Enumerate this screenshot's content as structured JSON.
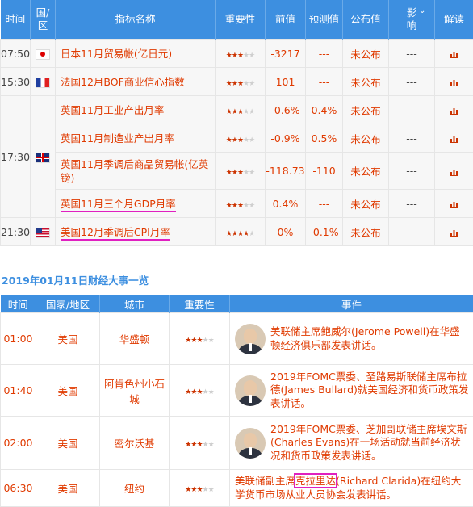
{
  "table1": {
    "headers": {
      "time": "时间",
      "country": "国/区",
      "indicator": "指标名称",
      "importance": "重要性",
      "previous": "前值",
      "forecast": "预测值",
      "actual": "公布值",
      "impact": "影响",
      "impact_icon": "chevron-down-icon",
      "interpret": "解读"
    },
    "rows": [
      {
        "time": "07:50",
        "flag": "japan",
        "name": "日本11月贸易帐(亿日元)",
        "stars": 3,
        "previous": "-3217",
        "forecast": "---",
        "actual": "未公布",
        "impact": "---"
      },
      {
        "time": "15:30",
        "flag": "france",
        "name": "法国12月BOF商业信心指数",
        "stars": 3,
        "previous": "101",
        "forecast": "---",
        "actual": "未公布",
        "impact": "---"
      },
      {
        "time": "17:30",
        "flag": "uk",
        "name": "英国11月工业产出月率",
        "stars": 3,
        "previous": "-0.6%",
        "forecast": "0.4%",
        "actual": "未公布",
        "impact": "---"
      },
      {
        "time": "",
        "flag": "",
        "name": "英国11月制造业产出月率",
        "stars": 3,
        "previous": "-0.9%",
        "forecast": "0.5%",
        "actual": "未公布",
        "impact": "---"
      },
      {
        "time": "",
        "flag": "",
        "name": "英国11月季调后商品贸易帐(亿英镑)",
        "stars": 3,
        "previous": "-118.73",
        "forecast": "-110",
        "actual": "未公布",
        "impact": "---"
      },
      {
        "time": "",
        "flag": "",
        "name": "英国11月三个月GDP月率",
        "stars": 3,
        "previous": "0.4%",
        "forecast": "---",
        "actual": "未公布",
        "impact": "---"
      },
      {
        "time": "21:30",
        "flag": "usa",
        "name": "美国12月季调后CPI月率",
        "stars": 4,
        "previous": "0%",
        "forecast": "-0.1%",
        "actual": "未公布",
        "impact": "---"
      }
    ]
  },
  "events_section": {
    "title": "2019年01月11日财经大事一览",
    "headers": {
      "time": "时间",
      "country": "国家/地区",
      "city": "城市",
      "importance": "重要性",
      "event": "事件"
    },
    "rows": [
      {
        "time": "01:00",
        "country": "美国",
        "city": "华盛顿",
        "stars": 3,
        "avatar": "powell-avatar",
        "event": "美联储主席鲍威尔(Jerome Powell)在华盛顿经济俱乐部发表讲话。"
      },
      {
        "time": "01:40",
        "country": "美国",
        "city": "阿肯色州小石城",
        "stars": 3,
        "avatar": "bullard-avatar",
        "event": "2019年FOMC票委、圣路易斯联储主席布拉德(James Bullard)就美国经济和货币政策发表讲话。"
      },
      {
        "time": "02:00",
        "country": "美国",
        "city": "密尔沃基",
        "stars": 3,
        "avatar": "evans-avatar",
        "event": "2019年FOMC票委、芝加哥联储主席埃文斯(Charles Evans)在一场活动就当前经济状况和货币政策发表讲话。"
      },
      {
        "time": "06:30",
        "country": "美国",
        "city": "纽约",
        "stars": 3,
        "avatar": "",
        "event_pre": "美联储副主席",
        "event_hl": "克拉里达",
        "event_post": "(Richard Clarida)在纽约大学货币市场从业人员协会发表讲话。"
      }
    ]
  },
  "colors": {
    "header_blue": "#3d8fe0",
    "text_red": "#e03a00",
    "star_red": "#cc3300",
    "highlight_magenta": "#e020c0"
  }
}
